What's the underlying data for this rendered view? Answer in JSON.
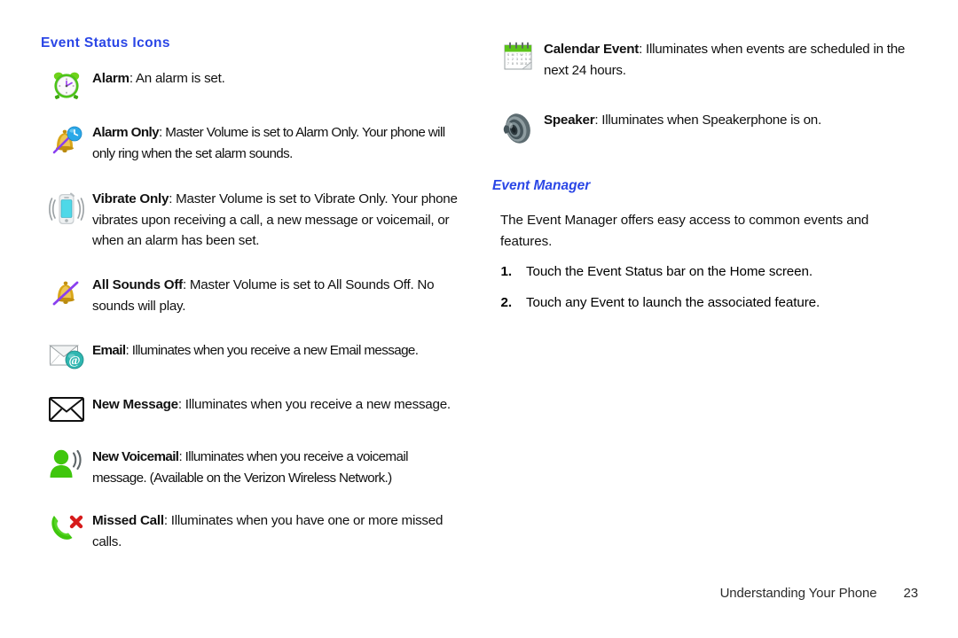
{
  "document": {
    "left_column": {
      "heading": "Event Status Icons",
      "entries": [
        {
          "icon": "alarm-clock-icon",
          "term": "Alarm",
          "description": ": An alarm is set."
        },
        {
          "icon": "bell-clock-alarm-only-icon",
          "term": "Alarm Only",
          "description": ": Master Volume is set to Alarm Only. Your phone will only ring when the set alarm sounds."
        },
        {
          "icon": "vibrating-phone-icon",
          "term": "Vibrate Only",
          "description": ": Master Volume is set to Vibrate Only. Your phone vibrates upon receiving a call, a new message or voicemail, or when an alarm has been set."
        },
        {
          "icon": "bell-muted-icon",
          "term": "All Sounds Off",
          "description": ": Master Volume is set to All Sounds Off. No sounds will play."
        },
        {
          "icon": "email-envelope-at-icon",
          "term": "Email",
          "description": ": Illuminates when you receive a new Email message."
        },
        {
          "icon": "new-message-envelope-icon",
          "term": "New Message",
          "description": ": Illuminates when you receive a new message."
        },
        {
          "icon": "voicemail-person-icon",
          "term": "New Voicemail",
          "description": ": Illuminates when you receive a voicemail message. (Available on the Verizon Wireless Network.)"
        },
        {
          "icon": "missed-call-icon",
          "term": "Missed Call",
          "description": ": Illuminates when you have one or more missed calls."
        }
      ]
    },
    "right_column": {
      "entries": [
        {
          "icon": "calendar-event-icon",
          "term": "Calendar Event",
          "description": ": Illuminates when events are scheduled in the next 24 hours."
        },
        {
          "icon": "speaker-icon",
          "term": "Speaker",
          "description": ": Illuminates when Speakerphone is on."
        }
      ],
      "heading": "Event Manager",
      "intro": "The Event Manager offers easy access to common events and features.",
      "steps": [
        {
          "number": "1.",
          "text": "Touch the Event Status bar on the Home screen."
        },
        {
          "number": "2.",
          "text": "Touch any Event to launch the associated feature."
        }
      ]
    },
    "footer": {
      "chapter": "Understanding Your Phone",
      "page_number": "23"
    },
    "colors": {
      "heading_blue": "#2a46e6",
      "body_text": "#111111",
      "icon_green": "#4cc417",
      "icon_gold": "#d9a61a",
      "icon_purple": "#8a3ff0",
      "icon_blue": "#2aa8e8",
      "icon_red": "#d61b1b",
      "icon_teal": "#2fb6b0",
      "icon_gray": "#6b7478"
    }
  }
}
